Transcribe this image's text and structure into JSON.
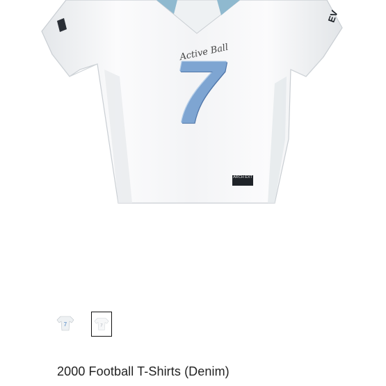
{
  "product": {
    "title": "2000 Football T-Shirts (Denim)",
    "jersey_number": "7",
    "script_text": "Active Ball",
    "sleeve_text": "EV",
    "tag_text": "ARCH EXT"
  },
  "gallery": {
    "thumbnails": [
      {
        "label": "7",
        "selected": false
      },
      {
        "label": "7",
        "selected": true
      }
    ]
  },
  "colors": {
    "jersey": "#f4f5f6",
    "jersey_shade": "#dde1e4",
    "number": "#8fb3d9",
    "number_dark": "#5f86b8",
    "collar_accent": "#8fb9cf",
    "thumb_border": "#111111"
  }
}
